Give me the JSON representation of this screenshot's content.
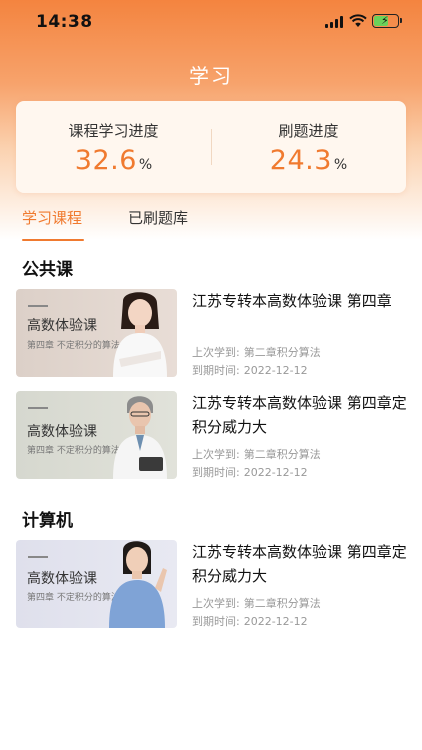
{
  "status_bar": {
    "time": "14:38"
  },
  "header": {
    "title": "学习"
  },
  "progress": {
    "course": {
      "label": "课程学习进度",
      "value": "32.6",
      "unit": "%"
    },
    "practice": {
      "label": "刷题进度",
      "value": "24.3",
      "unit": "%"
    }
  },
  "tabs": [
    {
      "label": "学习课程",
      "active": true
    },
    {
      "label": "已刷题库",
      "active": false
    }
  ],
  "sections": [
    {
      "title": "公共课",
      "courses": [
        {
          "thumb_title": "高数体验课",
          "thumb_sub": "第四章 不定积分的算法",
          "title": "江苏专转本高数体验课 第四章",
          "last_label": "上次学到:",
          "last_value": "第二章积分算法",
          "expire_label": "到期时间:",
          "expire_value": "2022-12-12"
        },
        {
          "thumb_title": "高数体验课",
          "thumb_sub": "第四章 不定积分的算法",
          "title": "江苏专转本高数体验课 第四章定积分威力大",
          "last_label": "上次学到:",
          "last_value": "第二章积分算法",
          "expire_label": "到期时间:",
          "expire_value": "2022-12-12"
        }
      ]
    },
    {
      "title": "计算机",
      "courses": [
        {
          "thumb_title": "高数体验课",
          "thumb_sub": "第四章 不定积分的算法",
          "title": "江苏专转本高数体验课 第四章定积分威力大",
          "last_label": "上次学到:",
          "last_value": "第二章积分算法",
          "expire_label": "到期时间:",
          "expire_value": "2022-12-12"
        }
      ]
    }
  ],
  "colors": {
    "accent": "#f07a2f",
    "header_top": "#f4843f"
  },
  "icons": [
    "signal-icon",
    "wifi-icon",
    "battery-icon"
  ]
}
